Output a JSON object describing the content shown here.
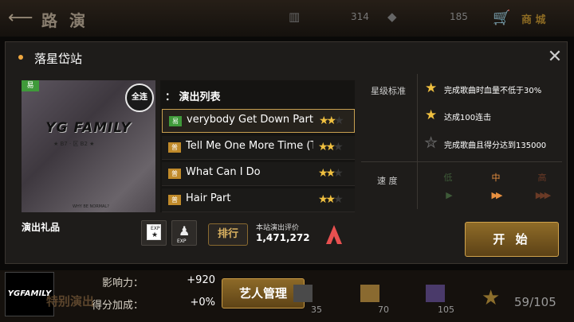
{
  "top_bar": {
    "title": "路 演",
    "stat1": "314",
    "stat2": "185",
    "shop_label": "商 城"
  },
  "modal": {
    "title": "落星岱站",
    "album": {
      "difficulty_tag": "易",
      "fc_badge": "全连",
      "cover_text": "YG FAMILY",
      "cover_sub": "★ B7 · 区 B2 ★",
      "cover_foot": "WHY BE NORMAL?"
    },
    "list": {
      "header": "：  演出列表",
      "songs": [
        {
          "tag": "易",
          "name": "verybody Get Down Part 2",
          "stars": 2,
          "max_stars": 3,
          "selected": true
        },
        {
          "tag": "普",
          "name": "Tell Me One More Time (Th",
          "stars": 2,
          "max_stars": 3,
          "selected": false
        },
        {
          "tag": "普",
          "name": "What Can I Do",
          "stars": 2,
          "max_stars": 3,
          "selected": false
        },
        {
          "tag": "普",
          "name": "Hair Part",
          "stars": 2,
          "max_stars": 3,
          "selected": false
        }
      ]
    },
    "gift_label": "演出礼品",
    "gift1_text": "EXP",
    "gift2_text": "EXP",
    "rank_button": "排行",
    "rating_label": "本站演出评价",
    "rating_value": "1,471,272",
    "criteria": {
      "label": "星级标准",
      "items": [
        {
          "text": "完成歌曲时血量不低于30%",
          "achieved": true
        },
        {
          "text": "达成100连击",
          "achieved": true
        },
        {
          "text": "完成歌曲且得分达到135000",
          "achieved": false
        }
      ]
    },
    "speed": {
      "label": "速 度",
      "options": [
        {
          "name": "低",
          "arrows": "▶",
          "active": false
        },
        {
          "name": "中",
          "arrows": "▶▶",
          "active": true
        },
        {
          "name": "高",
          "arrows": "▶▶▶",
          "active": false
        }
      ]
    },
    "start_button": "开 始"
  },
  "bottom_bar": {
    "artist_logo": "YGFAMILY",
    "influence_label": "影响力：",
    "influence_value": "+920",
    "score_bonus_label": "得分加成：",
    "score_bonus_value": "+0%",
    "artist_manage_button": "艺人管理",
    "special_show": "特别演出",
    "item1_count": "35",
    "item2_count": "70",
    "item3_count": "105",
    "star_progress": "59/105"
  },
  "colors": {
    "accent_gold": "#d0a24c",
    "star_gold": "#f0c040",
    "speed_active": "#e89040",
    "easy_tag": "#3f9a3a",
    "normal_tag": "#c08a2a"
  }
}
